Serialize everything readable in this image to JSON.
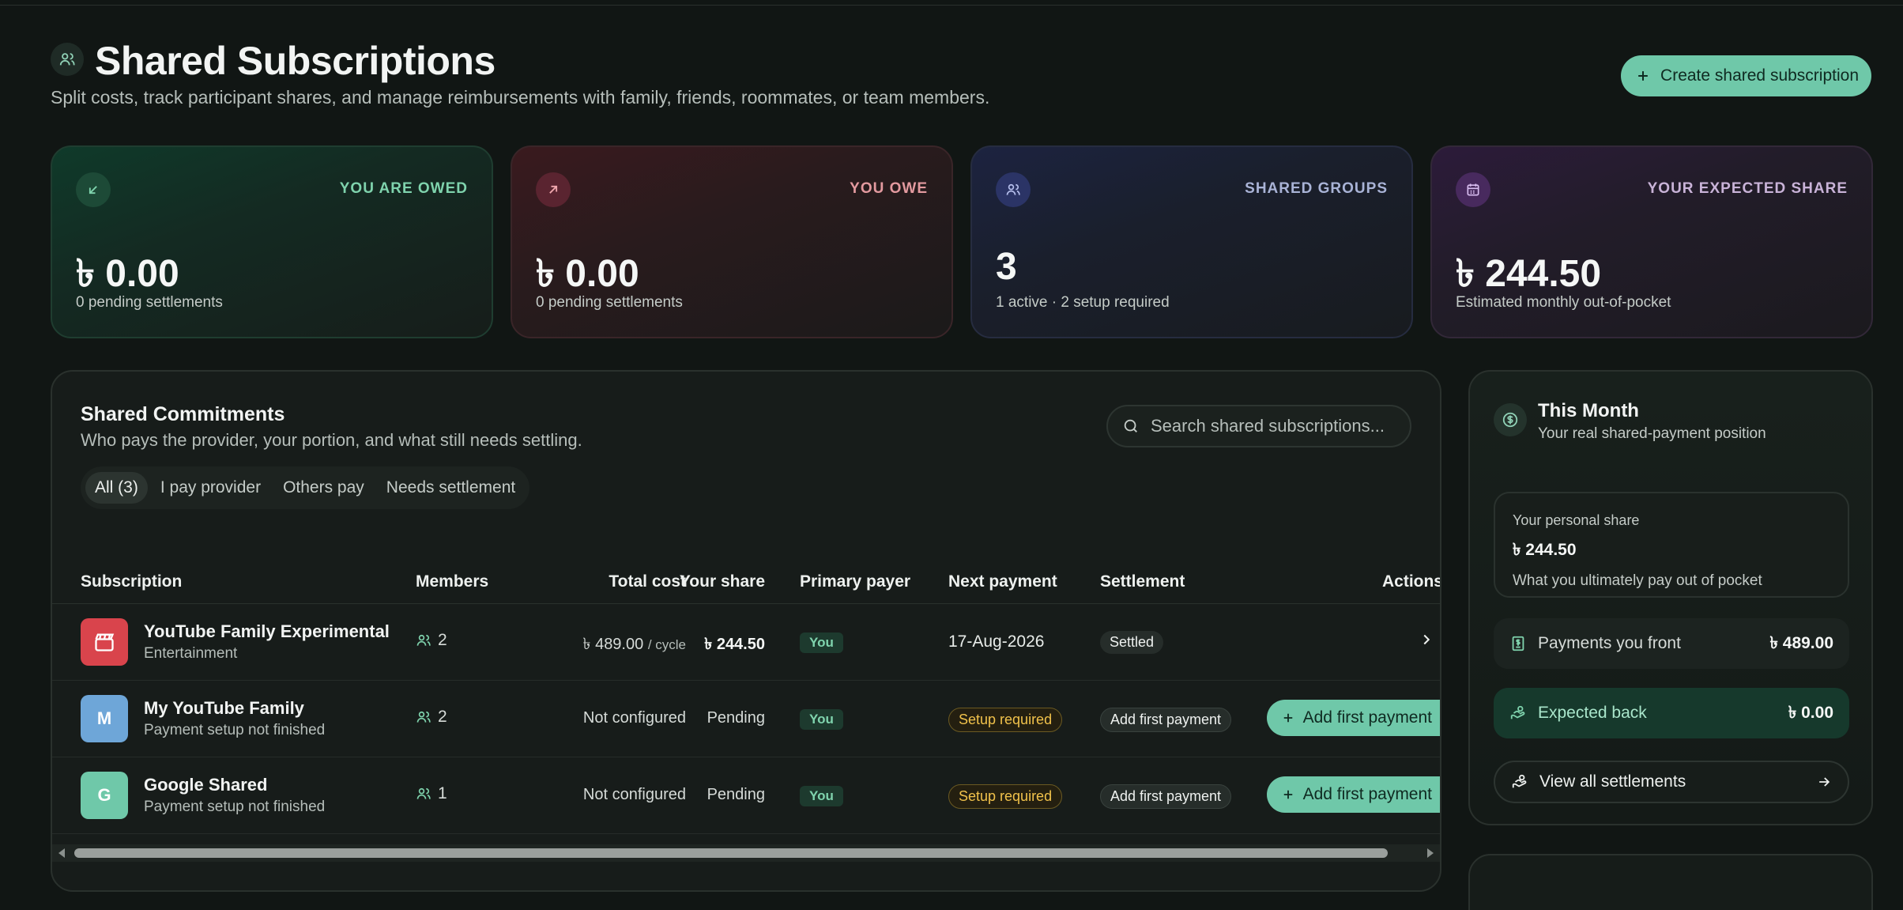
{
  "header": {
    "title": "Shared Subscriptions",
    "subtitle": "Split costs, track participant shares, and manage reimbursements with family, friends, roommates, or team members.",
    "create_button": "Create shared subscription"
  },
  "stats": {
    "owed": {
      "label": "YOU ARE OWED",
      "value": "৳ 0.00",
      "sub": "0 pending settlements",
      "icon": "arrow-down-left-icon"
    },
    "owe": {
      "label": "YOU OWE",
      "value": "৳ 0.00",
      "sub": "0 pending settlements",
      "icon": "arrow-up-right-icon"
    },
    "groups": {
      "label": "SHARED GROUPS",
      "value": "3",
      "sub": "1 active · 2 setup required",
      "icon": "users-icon"
    },
    "expected": {
      "label": "YOUR EXPECTED SHARE",
      "value": "৳ 244.50",
      "sub": "Estimated monthly out-of-pocket",
      "icon": "calendar-icon"
    }
  },
  "commitments": {
    "title": "Shared Commitments",
    "subtitle": "Who pays the provider, your portion, and what still needs settling.",
    "search_placeholder": "Search shared subscriptions...",
    "filters": [
      "All (3)",
      "I pay provider",
      "Others pay",
      "Needs settlement"
    ],
    "columns": [
      "Subscription",
      "Members",
      "Total cost",
      "Your share",
      "Primary payer",
      "Next payment",
      "Settlement",
      "Actions"
    ],
    "rows": [
      {
        "name": "YouTube Family Experimental",
        "category": "Entertainment",
        "avatar": "",
        "avatar_color": "#d9444c",
        "members": "2",
        "total": "৳ 489.00",
        "total_suffix": "/ cycle",
        "share": "৳ 244.50",
        "payer": "You",
        "next": "17-Aug-2026",
        "settlement": "Settled",
        "action": ""
      },
      {
        "name": "My YouTube Family",
        "category": "Payment setup not finished",
        "avatar": "M",
        "avatar_color": "#6ea6d8",
        "members": "2",
        "total": "Not configured",
        "total_suffix": "",
        "share": "Pending",
        "payer": "You",
        "next": "Setup required",
        "settlement": "Add first payment",
        "action": "Add first payment"
      },
      {
        "name": "Google Shared",
        "category": "Payment setup not finished",
        "avatar": "G",
        "avatar_color": "#6fc8a9",
        "members": "1",
        "total": "Not configured",
        "total_suffix": "",
        "share": "Pending",
        "payer": "You",
        "next": "Setup required",
        "settlement": "Add first payment",
        "action": "Add first payment"
      }
    ]
  },
  "month": {
    "title": "This Month",
    "subtitle": "Your real shared-payment position",
    "share_label": "Your personal share",
    "share_value": "৳ 244.50",
    "share_note": "What you ultimately pay out of pocket",
    "front_label": "Payments you front",
    "front_value": "৳ 489.00",
    "back_label": "Expected back",
    "back_value": "৳ 0.00",
    "view_all": "View all settlements"
  },
  "colors": {
    "accent": "#6fc8a9",
    "warning": "#f1c24b"
  }
}
